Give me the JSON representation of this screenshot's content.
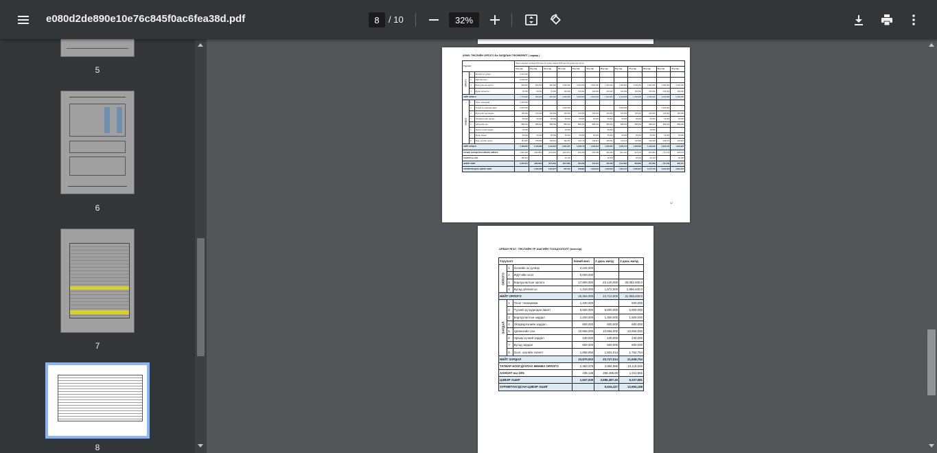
{
  "toolbar": {
    "filename": "e080d2de890e10e76c845f0ac6fea38d.pdf",
    "current_page": "8",
    "page_total": "/ 10",
    "zoom": "32%"
  },
  "sidebar": {
    "thumbnails": [
      {
        "label": "5"
      },
      {
        "label": "6"
      },
      {
        "label": "7"
      },
      {
        "label": "8"
      }
    ]
  },
  "page12": {
    "heading": "АРАВ: ТӨСЛИЙН ОРЛОГО Ба ЗАРДЛЫН ТӨСӨВЛӨЛТ ( сараар )",
    "col_item": "Үзүүлэлт",
    "period_header": "Төсөл хэрэгжих хугацаа 2014 оны 11 дүгээр сараас 2015 оны 10 дугаар сар хүртэл",
    "months": [
      "11-р сар",
      "12-р сар",
      "01-р сар",
      "02-р сар",
      "03-р сар",
      "04-р сар",
      "05-р сар",
      "06-р сар",
      "07-р сар",
      "08-р сар",
      "09-р сар",
      "10-р сар"
    ],
    "income_group": "ОРЛОГО",
    "income_rows": [
      {
        "n": "1",
        "name": "Зээлийн эх үүсвэр",
        "vals": [
          "2,244,000",
          "",
          "",
          "",
          "",
          "",
          "",
          "",
          "",
          "",
          "",
          ""
        ]
      },
      {
        "n": "2",
        "name": "ЖДҮ-ийн зээл",
        "vals": [
          "5,000,000",
          "",
          "",
          "",
          "",
          "",
          "",
          "",
          "",
          "",
          "",
          ""
        ]
      },
      {
        "n": "3",
        "name": "Борлуулалтын орлого",
        "vals": [
          "500,000",
          "500,000",
          "800,000",
          "1,500,000",
          "1,500,000",
          "1,500,000",
          "1,500,000",
          "2,000,000",
          "2,000,000",
          "2,000,000",
          "2,000,000",
          "2,000,000"
        ]
      },
      {
        "n": "4",
        "name": "Бусад үйлчилгээ",
        "vals": [
          "30,000",
          "50,000",
          "70,000",
          "100,000",
          "100,000",
          "120,000",
          "120,000",
          "120,000",
          "150,000",
          "150,000",
          "150,000",
          "150,000"
        ]
      }
    ],
    "income_total": {
      "name": "НИЙТ ОРЛОГО",
      "vals": [
        "7,774,000",
        "550,000",
        "870,000",
        "1,600,000",
        "1,600,000",
        "1,620,000",
        "1,620,000",
        "2,120,000",
        "2,150,000",
        "2,150,000",
        "2,150,000",
        "2,150,000"
      ]
    },
    "expense_group": "ЗАРДАЛ",
    "expense_rows": [
      {
        "n": "1",
        "name": "Тоног төхөөрөмж",
        "vals": [
          "1,420,000",
          "",
          "",
          "",
          "",
          "",
          "",
          "",
          "",
          "",
          "",
          ""
        ]
      },
      {
        "n": "2",
        "name": "Түүхий эд худалдан авалт",
        "vals": [
          "2,500,000",
          "",
          "",
          "1,000,000",
          "",
          "",
          "",
          "1,000,000",
          "",
          "",
          "1,000,000",
          ""
        ]
      },
      {
        "n": "3",
        "name": "Борлуулалтын зардал",
        "vals": [
          "100,000",
          "100,000",
          "100,000",
          "100,000",
          "100,000",
          "100,000",
          "100,000",
          "100,000",
          "100,000",
          "100,000",
          "100,000",
          "100,000"
        ]
      },
      {
        "n": "4",
        "name": "Үйлдвэрлэлийн зардал",
        "vals": [
          "50,000",
          "50,000",
          "50,000",
          "50,000",
          "50,000",
          "50,000",
          "50,000",
          "50,000",
          "50,000",
          "50,000",
          "50,000",
          "50,000"
        ]
      },
      {
        "n": "5",
        "name": "Цалингийн сан",
        "vals": [
          "888,000",
          "888,000",
          "888,000",
          "888,000",
          "888,000",
          "888,000",
          "888,000",
          "888,000",
          "888,000",
          "888,000",
          "888,000",
          "888,000"
        ]
      },
      {
        "n": "6",
        "name": "Эрчим хүчний зардал",
        "vals": [
          "20,000",
          "",
          "",
          "20,000",
          "",
          "",
          "20,000",
          "",
          "",
          "20,000",
          "",
          ""
        ]
      },
      {
        "n": "7",
        "name": "Бусад зардал",
        "vals": [
          "50,000",
          "50,000",
          "50,000",
          "50,000",
          "50,000",
          "50,000",
          "50,000",
          "50,000",
          "50,000",
          "50,000",
          "50,000",
          "50,000"
        ]
      },
      {
        "n": "8",
        "name": "Зээл, хүүгийн төлөлт",
        "vals": [
          "161,662",
          "158,866",
          "156,061",
          "153,257",
          "150,710",
          "148,212",
          "145,662",
          "143,114",
          "140,566",
          "138,018",
          "135,470",
          "132,922"
        ]
      }
    ],
    "expense_total": {
      "name": "НИЙТ ЗАРДАЛ",
      "vals": [
        "5,189,662",
        "1,246,866",
        "1,244,061",
        "2,261,257",
        "1,238,710",
        "1,236,212",
        "1,253,662",
        "2,231,114",
        "1,228,566",
        "1,246,018",
        "2,223,470",
        "1,220,922"
      ]
    },
    "pre_tax": {
      "name": "ТАТВАР НООГДУУЛАХ ӨМНӨХ ОРЛОГО",
      "vals": [
        "2,584,338",
        "(696,866)",
        "(374,061)",
        "(661,257)",
        "361,290",
        "383,788",
        "366,338",
        "(111,114)",
        "921,434",
        "903,982",
        "(73,470)",
        "929,078"
      ]
    },
    "tax": {
      "name": "ААНОАТ ны 10%",
      "vals": [
        "258,434",
        "",
        "",
        "36,129",
        "",
        "",
        "38,378",
        "",
        "36,634",
        "92,143",
        "",
        "92,908"
      ]
    },
    "net": {
      "name": "ЦЭВЭР АШИГ",
      "vals": [
        "2,325,904",
        "(696,866)",
        "(374,061)",
        "(697,386)",
        "361,290",
        "345,410",
        "366,338",
        "(149,492)",
        "884,800",
        "811,839",
        "(73,470)",
        "836,170"
      ]
    },
    "cumulative": {
      "name": "ХУРИМТЛАГДСАН ЦЭВЭР АШИГ",
      "vals": [
        "",
        "1,629,038",
        "1,254,977",
        "557,591",
        "918,881",
        "1,264,291",
        "1,630,629",
        "1,481,137",
        "2,365,937",
        "3,177,776",
        "3,104,306",
        "3,940,476"
      ]
    },
    "page_number": "12"
  },
  "page13": {
    "heading": "АРВАН ЯГАГ: ТӨСЛИЙН ҮР АШГИЙН ТООЦООЛОЛТ (жилээр)",
    "col_item": "Үзүүлэлт",
    "years": [
      "Эхний жил",
      "2 дахь жилд",
      "3 дахь жилд"
    ],
    "income_group": "ОРЛОГО",
    "income_rows": [
      {
        "n": "1",
        "name": "Зээлийн эх үүсвэр",
        "vals": [
          "2,244,000",
          "",
          ""
        ]
      },
      {
        "n": "2",
        "name": "ЖДҮ-ийн зээл",
        "vals": [
          "5,000,000",
          "",
          ""
        ]
      },
      {
        "n": "3",
        "name": "Борлуулалтын орлого",
        "vals": [
          "17,800,000",
          "23,140,000",
          "30,082,000.0"
        ]
      },
      {
        "n": "4",
        "name": "Бусад үйлчилгээ",
        "vals": [
          "1,310,000",
          "1,572,000",
          "1,886,400.0"
        ]
      }
    ],
    "income_total": {
      "name": "НИЙТ ОРЛОГО",
      "vals": [
        "26,354,000",
        "24,712,000",
        "31,968,400.0"
      ]
    },
    "expense_group": "ЗАРДАЛ",
    "expense_rows": [
      {
        "n": "1",
        "name": "Тоног төхөөрөмж",
        "vals": [
          "1,420,000",
          "",
          "500,000"
        ]
      },
      {
        "n": "2",
        "name": "Түүхий эд худалдан авалт",
        "vals": [
          "5,500,000",
          "5,500,000",
          "6,000,000"
        ]
      },
      {
        "n": "3",
        "name": "Борлуулалтын зардал",
        "vals": [
          "1,200,000",
          "1,300,000",
          "1,500,000"
        ]
      },
      {
        "n": "4",
        "name": "Үйлдвэрлэлийн зардал",
        "vals": [
          "600,000",
          "600,000",
          "600,000"
        ]
      },
      {
        "n": "5",
        "name": "Цалингийн сан",
        "vals": [
          "10,656,000",
          "10,656,000",
          "10,656,000"
        ]
      },
      {
        "n": "6",
        "name": "Эрчим хүчний зардал",
        "vals": [
          "240,000",
          "240,000",
          "240,000"
        ]
      },
      {
        "n": "7",
        "name": "Бусад зардал",
        "vals": [
          "600,000",
          "600,000",
          "600,000"
        ]
      },
      {
        "n": "8",
        "name": "Зээл, хүүгийн төлөлт",
        "vals": [
          "1,858,892",
          "1,831,014",
          "1,752,754"
        ]
      }
    ],
    "expense_total": {
      "name": "НИЙТ ЗАРДАЛ",
      "vals": [
        "23,970,922",
        "20,727,014",
        "21,848,754"
      ]
    },
    "pre_tax": {
      "name": "ТАТВАР НООГДУУЛАХ ӨМНӨХ ОРЛОГО",
      "vals": [
        "2,383,078",
        "3,984,986",
        "10,119,646"
      ]
    },
    "tax": {
      "name": "ААНОАТ ны 10%",
      "vals": [
        "435,138",
        "398,498.60",
        "1,011,965"
      ]
    },
    "net": {
      "name": "ЦЭВЭР АШИГ",
      "vals": [
        "1,947,940",
        "3,586,487.40",
        "9,107,681"
      ]
    },
    "cumulative": {
      "name": "ХУРИМТЛАГДСАН ЦЭВЭР АШИГ",
      "vals": [
        "",
        "5,534,427",
        "12,694,168"
      ]
    }
  }
}
